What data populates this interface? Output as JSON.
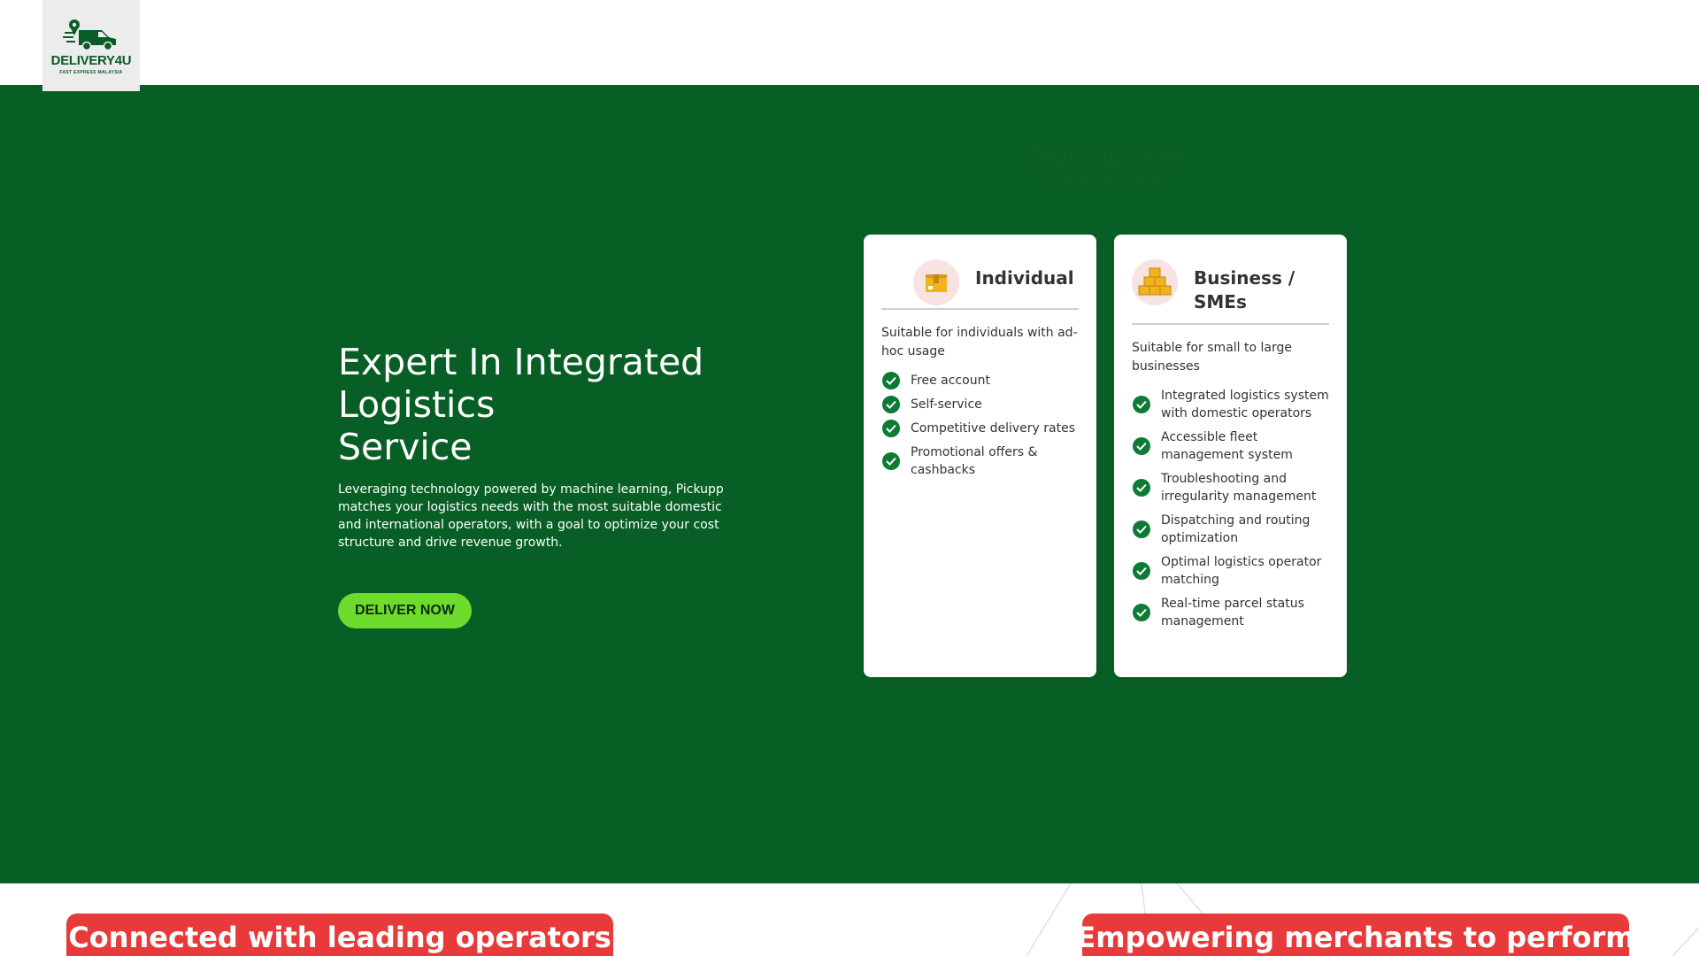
{
  "logo": {
    "name": "DELIVERY4U",
    "tagline": "FAST EXPRESS MALAYSIA"
  },
  "hero": {
    "title_line1": "Expert In Integrated",
    "title_line2": "Logistics",
    "title_line3": "Service",
    "description": "Leveraging technology powered by machine learning, Pickupp matches your logistics needs with the most suitable domestic and international operators, with a goal to optimize your cost structure and drive revenue growth.",
    "cta_label": "DELIVER NOW"
  },
  "signup": {
    "title": "Sign up now",
    "subtitle": "Free account setup"
  },
  "cards": {
    "individual": {
      "title": "Individual",
      "icon": "box-icon",
      "description": "Suitable for individuals with ad-hoc usage",
      "features": [
        "Free account",
        "Self-service",
        "Competitive delivery rates",
        "Promotional offers & cashbacks"
      ]
    },
    "business": {
      "title": "Business / SMEs",
      "icon": "stacked-boxes-icon",
      "description": "Suitable for small to large businesses",
      "features": [
        "Integrated logistics system with domestic operators",
        "Accessible fleet management system",
        "Troubleshooting and irregularity management",
        "Dispatching and routing optimization",
        "Optimal logistics operator matching",
        "Real-time parcel status management"
      ]
    }
  },
  "banners": {
    "left": "Connected with leading operators",
    "right": "Empowering merchants to perform"
  },
  "colors": {
    "hero_bg": "#085f25",
    "cta_bg": "#6ddc2c",
    "check": "#0d7a35",
    "banner": "#e83a3a",
    "brand_green": "#0a5c26"
  }
}
